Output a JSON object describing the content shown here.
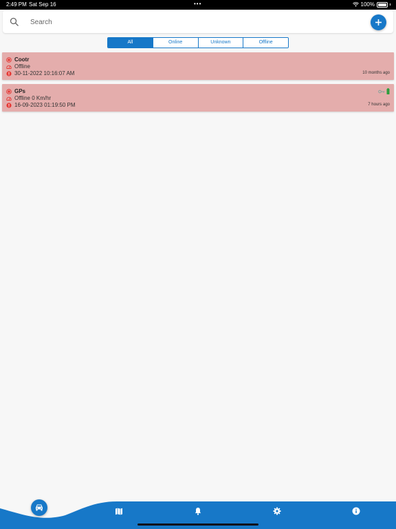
{
  "status_bar": {
    "time": "2:49 PM",
    "date": "Sat Sep 16",
    "battery": "100%"
  },
  "search": {
    "placeholder": "Search"
  },
  "filter_tabs": [
    {
      "label": "All",
      "active": true
    },
    {
      "label": "Online",
      "active": false
    },
    {
      "label": "Unknown",
      "active": false
    },
    {
      "label": "Offline",
      "active": false
    }
  ],
  "devices": [
    {
      "name": "Cootr",
      "status": "Offline",
      "timestamp": "30-11-2022 10:16:07 AM",
      "ago": "10 months ago"
    },
    {
      "name": "GPs",
      "status": "Offline 0 Km/hr",
      "timestamp": "16-09-2023 01:19:50 PM",
      "ago": "7 hours ago"
    }
  ],
  "colors": {
    "accent": "#1778c8",
    "offline_card": "#e4adac",
    "status_red": "#e53935"
  },
  "bottom_nav": [
    {
      "icon": "car-icon",
      "active": true
    },
    {
      "icon": "map-icon",
      "active": false
    },
    {
      "icon": "bell-icon",
      "active": false
    },
    {
      "icon": "gear-icon",
      "active": false
    },
    {
      "icon": "info-icon",
      "active": false
    }
  ]
}
